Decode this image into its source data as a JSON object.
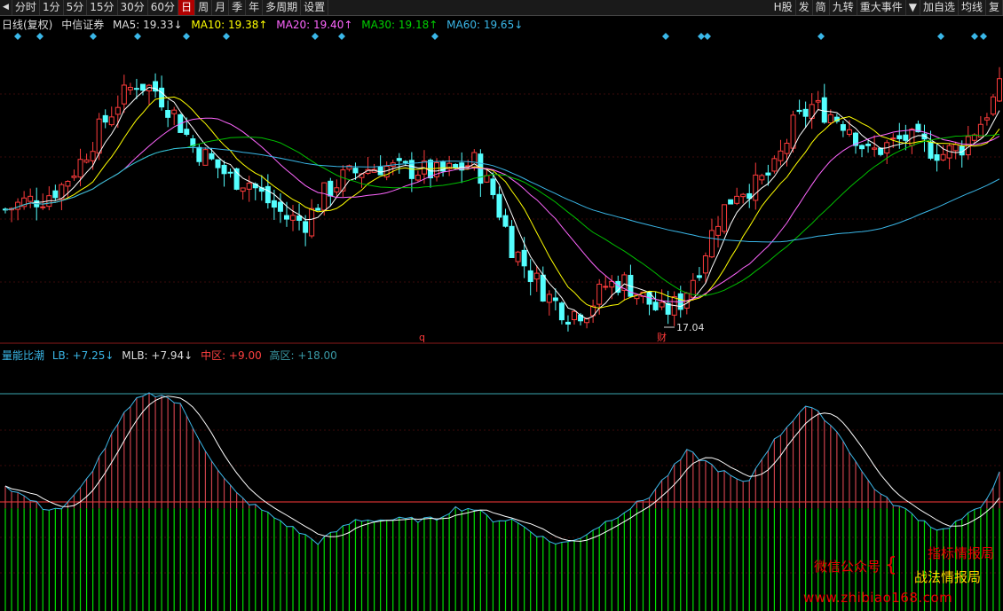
{
  "toolbar": {
    "back_arrow": "◀",
    "periods": [
      "分时",
      "1分",
      "5分",
      "15分",
      "30分",
      "60分",
      "日",
      "周",
      "月",
      "季",
      "年",
      "多周期",
      "设置"
    ],
    "active_period": "日",
    "right_items": [
      "H股",
      "发",
      "简",
      "九转",
      "重大事件",
      "▼",
      "加自选",
      "均线",
      "复"
    ]
  },
  "ma_legend": {
    "chart_label": "日线(复权)",
    "stock_name": "中信证券",
    "ma5": "MA5: 19.33↓",
    "ma10": "MA10: 19.38↑",
    "ma20": "MA20: 19.40↑",
    "ma30": "MA30: 19.18↑",
    "ma60": "MA60: 19.65↓"
  },
  "indicator_legend": {
    "name": "量能比潮",
    "lb": "LB: +7.25↓",
    "mlb": "MLB: +7.94↓",
    "mid": "中区: +9.00",
    "high": "高区: +18.00"
  },
  "annotations": {
    "low_price": "17.04",
    "marker_q": "q",
    "marker_cai": "财"
  },
  "watermark": {
    "wechat": "微信公众号",
    "brace": "{",
    "line1": "指标情报局",
    "line2": "战法情报局",
    "url": "www.zhibiao168.com"
  },
  "colors": {
    "up": "#ff3c3c",
    "down": "#54ffff",
    "ma5": "#ffffff",
    "ma10": "#ffff00",
    "ma20": "#ff66ff",
    "ma30": "#00c000",
    "ma60": "#3ab7e8",
    "lb_high": "#c8404a",
    "lb_low": "#00e000",
    "mlb": "#ffffff"
  },
  "chart_data": [
    {
      "type": "candlestick",
      "title": "日线(复权) 中信证券",
      "series": [
        {
          "name": "MA5",
          "last": 19.33
        },
        {
          "name": "MA10",
          "last": 19.38
        },
        {
          "name": "MA20",
          "last": 19.4
        },
        {
          "name": "MA30",
          "last": 19.18
        },
        {
          "name": "MA60",
          "last": 19.65
        }
      ],
      "annotations": [
        {
          "label": "17.04",
          "kind": "period-low"
        }
      ],
      "ohlc_close_trend": [
        19.8,
        20.0,
        20.1,
        20.4,
        21.0,
        21.8,
        22.5,
        23.0,
        22.8,
        22.2,
        21.4,
        21.0,
        20.6,
        20.5,
        20.0,
        19.6,
        19.5,
        20.2,
        20.6,
        20.8,
        20.9,
        20.8,
        20.8,
        20.7,
        20.8,
        21.0,
        20.2,
        18.9,
        18.2,
        17.6,
        17.2,
        17.3,
        17.9,
        18.0,
        17.6,
        17.2,
        17.5,
        18.4,
        19.6,
        20.3,
        20.4,
        20.8,
        21.9,
        22.4,
        22.2,
        21.9,
        21.2,
        21.4,
        21.6,
        21.4,
        21.2,
        21.4,
        22.0,
        22.8
      ]
    },
    {
      "type": "bar",
      "title": "量能比潮",
      "series": [
        {
          "name": "LB",
          "last": 7.25
        },
        {
          "name": "MLB",
          "last": 7.94
        }
      ],
      "thresholds": {
        "中区": 9.0,
        "高区": 18.0
      },
      "lb_trend": [
        11,
        10,
        9,
        9,
        11,
        14,
        17,
        19,
        19,
        18,
        15,
        12,
        10,
        9,
        8,
        7,
        6,
        7,
        8,
        8,
        8,
        8,
        8,
        9,
        9,
        8,
        8,
        7,
        6,
        6,
        7,
        8,
        9,
        10,
        12,
        14,
        13,
        12,
        11,
        14,
        16,
        18,
        17,
        15,
        12,
        10,
        9,
        8,
        7,
        8,
        9,
        12
      ]
    }
  ]
}
